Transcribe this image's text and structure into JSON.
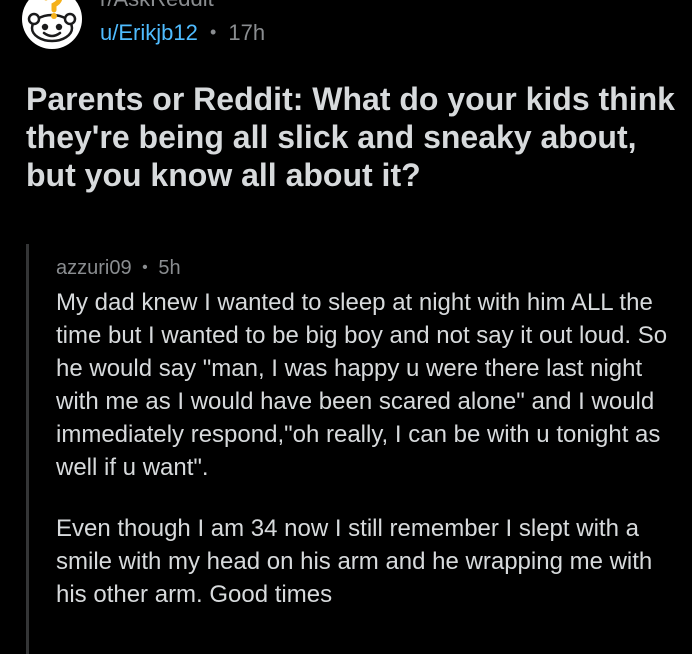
{
  "post": {
    "subreddit": "r/AskReddit",
    "author": "u/Erikjb12",
    "separator": "•",
    "age": "17h",
    "title": "Parents or Reddit: What do your kids think they're being all slick and sneaky about, but you know all about it?"
  },
  "comment": {
    "author": "azzuri09",
    "separator": "•",
    "age": "5h",
    "paragraphs": [
      "My dad knew I wanted to sleep at night with him ALL the time but I wanted to be big boy and not say it out loud. So he would say \"man, I was happy u were there last night with me as I would have been scared alone\" and I would immediately respond,\"oh really, I can be with u tonight as well if u want\".",
      "Even though I am 34 now I still remember I slept with a smile with my head on his arm and he wrapping me with his other arm. Good times"
    ]
  },
  "icons": {
    "avatar": "subreddit-question-mark-icon"
  },
  "colors": {
    "background": "#000000",
    "text": "#d7dadc",
    "muted": "#8a8d90",
    "username": "#4fbcff",
    "comment_thread_line": "#343536",
    "avatar_accent": "#f5b11a"
  }
}
